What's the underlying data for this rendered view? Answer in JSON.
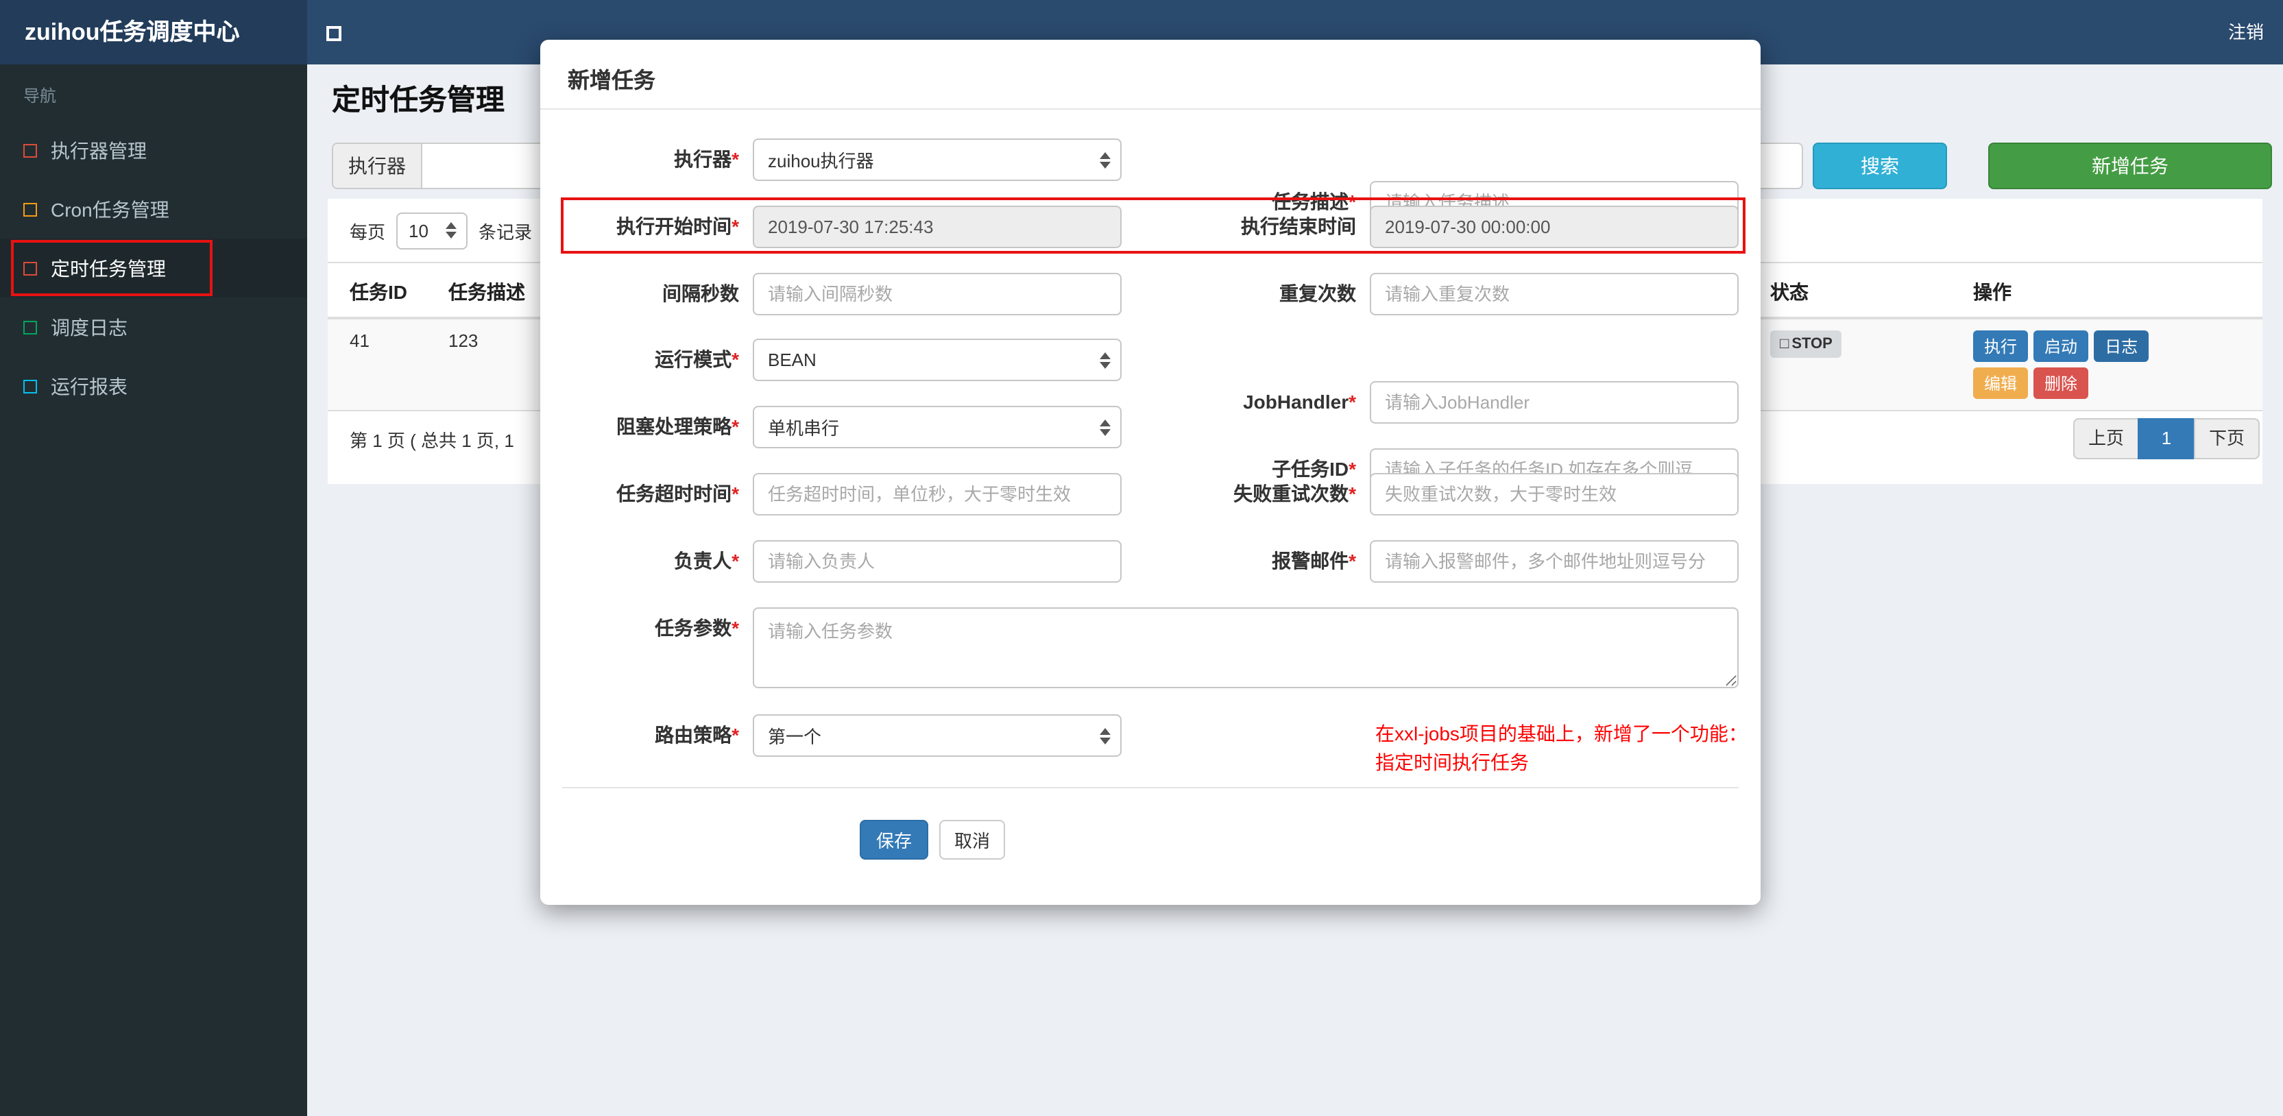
{
  "colors": {
    "navbar": "#2a4a6e",
    "logo_bg": "#223c5a",
    "sidebar_bg": "#222d32",
    "annotation_red": "#e81212",
    "primary_blue": "#337ab7",
    "log_blue": "#2e6da4",
    "warning_orange": "#f0ad4e",
    "danger_red": "#d9534f",
    "search_teal": "#31b0d5",
    "add_green": "#449d44",
    "required_star_red": "#e02222",
    "note_red": "#ff0000"
  },
  "navbar": {
    "brand": "zuihou任务调度中心",
    "toggle_icon": "□",
    "logout": "注销"
  },
  "sidebar": {
    "nav_header": "导航",
    "items": [
      {
        "label": "执行器管理",
        "icon_color": "#dd4b39"
      },
      {
        "label": "Cron任务管理",
        "icon_color": "#f39c12"
      },
      {
        "label": "定时任务管理",
        "icon_color": "#dd4b39",
        "active": true
      },
      {
        "label": "调度日志",
        "icon_color": "#00a65a"
      },
      {
        "label": "运行报表",
        "icon_color": "#00c0ef"
      }
    ]
  },
  "page": {
    "title": "定时任务管理",
    "filter": {
      "executor_label": "执行器",
      "search_button": "搜索",
      "add_button": "新增任务"
    },
    "per_page": {
      "label": "每页",
      "value": "10",
      "suffix": "条记录"
    },
    "table": {
      "headers": [
        "任务ID",
        "任务描述",
        "状态",
        "操作"
      ],
      "row": {
        "task_id": "41",
        "task_desc": "123",
        "status_icon": "□",
        "status": "STOP",
        "actions": {
          "run": "执行",
          "start": "启动",
          "log": "日志",
          "edit": "编辑",
          "delete": "删除"
        }
      }
    },
    "pagination": {
      "info": "第 1 页 ( 总共 1 页, 1",
      "prev": "上页",
      "current": "1",
      "next": "下页"
    }
  },
  "modal": {
    "title": "新增任务",
    "rows": [
      {
        "left": {
          "label": "执行器",
          "star": "*",
          "value": "zuihou执行器"
        },
        "right": {
          "label": "任务描述",
          "star": "*",
          "placeholder": "请输入任务描述"
        }
      },
      {
        "left": {
          "label": "执行开始时间",
          "star": "*",
          "value": "2019-07-30 17:25:43"
        },
        "right": {
          "label": "执行结束时间",
          "star": "",
          "value": "2019-07-30 00:00:00"
        }
      },
      {
        "left": {
          "label": "间隔秒数",
          "star": "",
          "placeholder": "请输入间隔秒数"
        },
        "right": {
          "label": "重复次数",
          "star": "",
          "placeholder": "请输入重复次数"
        }
      },
      {
        "left": {
          "label": "运行模式",
          "star": "*",
          "value": "BEAN"
        },
        "right": {
          "label": "JobHandler",
          "star": "*",
          "placeholder": "请输入JobHandler"
        }
      },
      {
        "left": {
          "label": "阻塞处理策略",
          "star": "*",
          "value": "单机串行"
        },
        "right": {
          "label": "子任务ID",
          "star": "*",
          "placeholder": "请输入子任务的任务ID,如存在多个则逗"
        }
      },
      {
        "left": {
          "label": "任务超时时间",
          "star": "*",
          "placeholder": "任务超时时间，单位秒，大于零时生效"
        },
        "right": {
          "label": "失败重试次数",
          "star": "*",
          "placeholder": "失败重试次数，大于零时生效"
        }
      },
      {
        "left": {
          "label": "负责人",
          "star": "*",
          "placeholder": "请输入负责人"
        },
        "right": {
          "label": "报警邮件",
          "star": "*",
          "placeholder": "请输入报警邮件，多个邮件地址则逗号分"
        }
      }
    ],
    "param_row": {
      "label": "任务参数",
      "star": "*",
      "placeholder": "请输入任务参数"
    },
    "route_row": {
      "label": "路由策略",
      "star": "*",
      "value": "第一个"
    },
    "note": {
      "line1": "在xxl-jobs项目的基础上，新增了一个功能：",
      "line2": "指定时间执行任务"
    },
    "buttons": {
      "save": "保存",
      "cancel": "取消"
    }
  }
}
